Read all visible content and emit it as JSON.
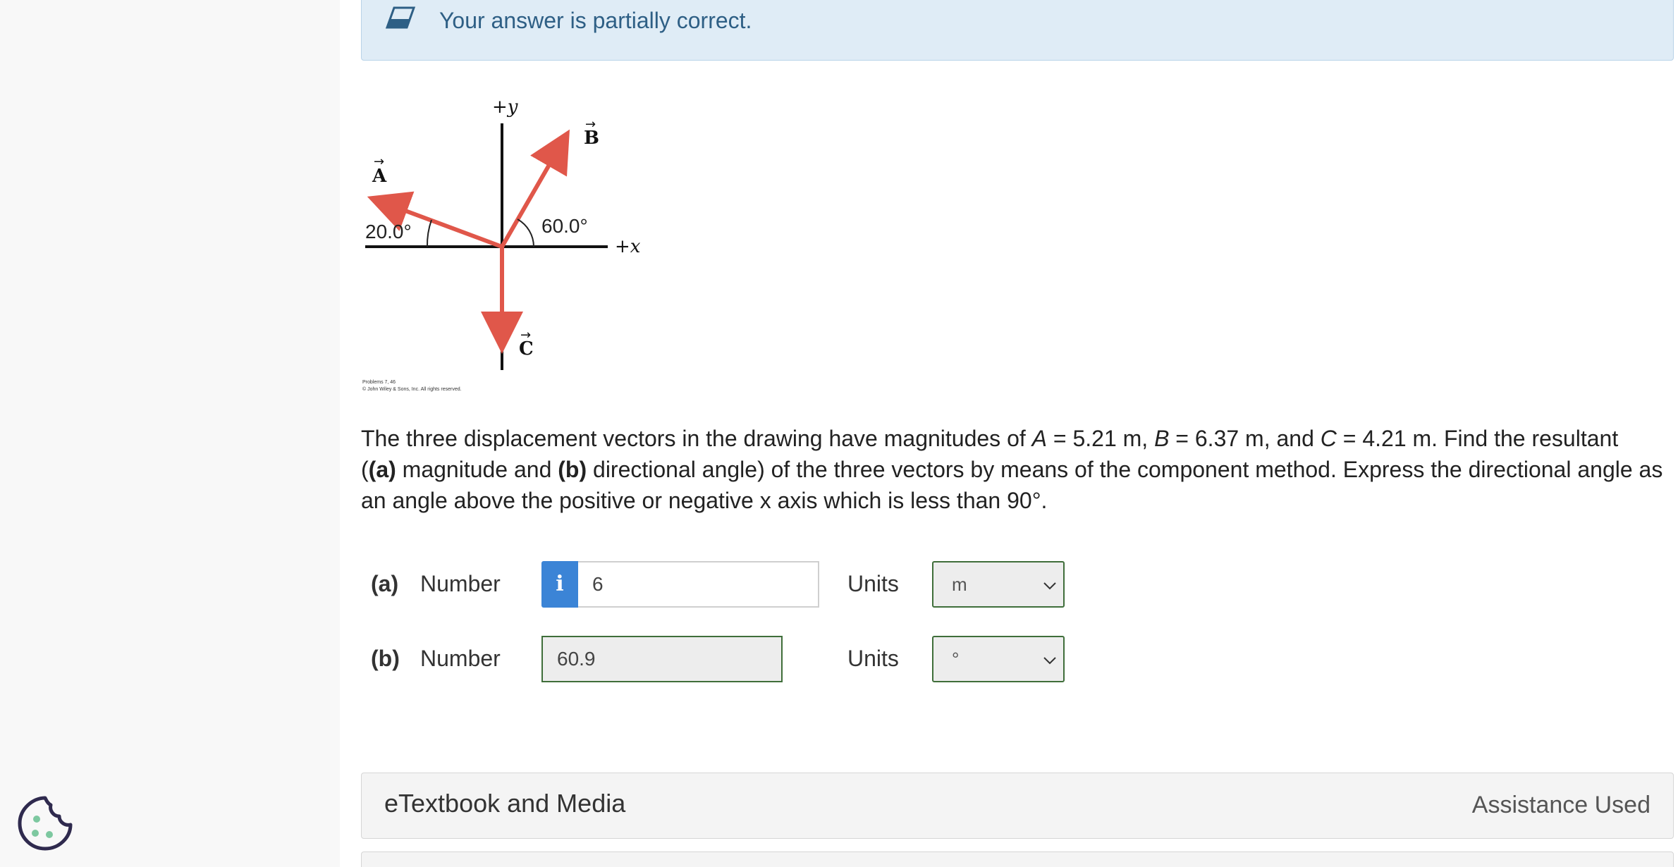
{
  "alert": {
    "icon": "eraser-icon",
    "message": "Your answer is partially correct."
  },
  "figure": {
    "y_axis_label": "+y",
    "x_axis_label": "+x",
    "vector_a_label": "A",
    "vector_b_label": "B",
    "vector_c_label": "C",
    "angle_a": "20.0°",
    "angle_b": "60.0°",
    "credit_line1": "Problems 7, 46",
    "credit_line2": "© John Wiley & Sons, Inc. All rights reserved.",
    "vector_color": "#e0574a"
  },
  "question": {
    "p1": "The three displacement vectors in the drawing have magnitudes of ",
    "a_var": "A",
    "a_val": " = 5.21 m, ",
    "b_var": "B",
    "b_val": " = 6.37 m, and ",
    "c_var": "C",
    "c_val": " = 4.21 m. Find the resultant",
    "p2": "(",
    "part_a": "(a)",
    "p3": " magnitude and ",
    "part_b": "(b)",
    "p4": " directional angle) of the three vectors by means of the component method. Express the directional angle as an angle above the positive or negative x axis which is less than 90°."
  },
  "part_a": {
    "label": "(a)",
    "number_label": "Number",
    "info_icon": "i",
    "value": "6",
    "units_label": "Units",
    "units_value": "m"
  },
  "part_b": {
    "label": "(b)",
    "number_label": "Number",
    "value": "60.9",
    "units_label": "Units",
    "units_value": "°"
  },
  "panel": {
    "title": "eTextbook and Media",
    "status": "Assistance Used"
  },
  "cookie": {
    "icon": "cookie-icon"
  }
}
